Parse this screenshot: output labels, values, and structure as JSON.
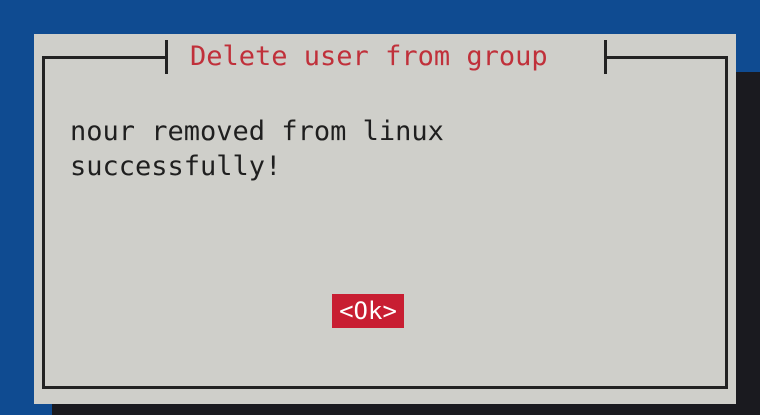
{
  "dialog": {
    "title": "Delete user from group",
    "message": "nour removed from linux\nsuccessfully!",
    "ok_label": "<Ok>"
  },
  "colors": {
    "background": "#0f4b91",
    "dialog": "#cfcfca",
    "title": "#c0303a",
    "button": "#c81e32",
    "button_text": "#ffffff",
    "border": "#222222"
  }
}
